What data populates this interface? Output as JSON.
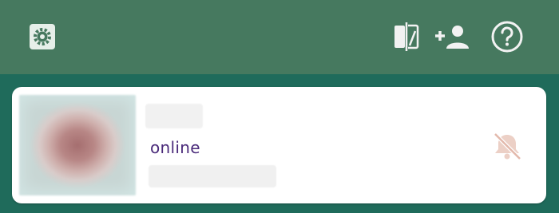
{
  "toolbar": {
    "icons": [
      "settings-icon",
      "swap-panels-icon",
      "add-contact-icon",
      "help-icon"
    ]
  },
  "contact": {
    "status": "online",
    "mute_icon": "notifications-off-icon"
  },
  "colors": {
    "toolbar_bg": "#46795f",
    "page_bg": "#1f6b5b",
    "status_text": "#4a2a7a",
    "mute_icon": "#e8c3b6"
  }
}
